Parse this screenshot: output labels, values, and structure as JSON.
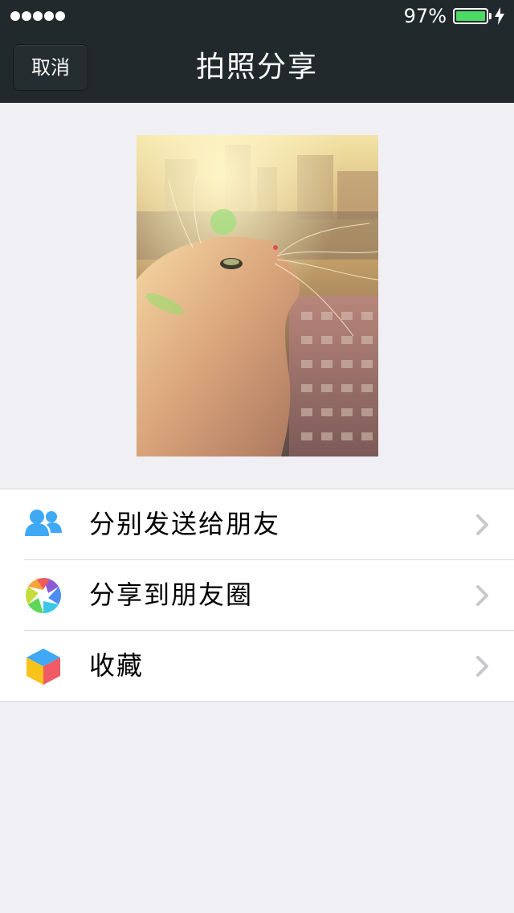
{
  "status_bar": {
    "battery_percent": "97%",
    "signal_dots": 5,
    "battery_color": "#4cd964"
  },
  "nav": {
    "cancel_label": "取消",
    "title": "拍照分享",
    "background": "#22292c"
  },
  "photo": {
    "icon": "cat-photo"
  },
  "share_options": [
    {
      "label": "分别发送给朋友",
      "icon": "friends-icon"
    },
    {
      "label": "分享到朋友圈",
      "icon": "moments-icon"
    },
    {
      "label": "收藏",
      "icon": "favorites-icon"
    }
  ]
}
